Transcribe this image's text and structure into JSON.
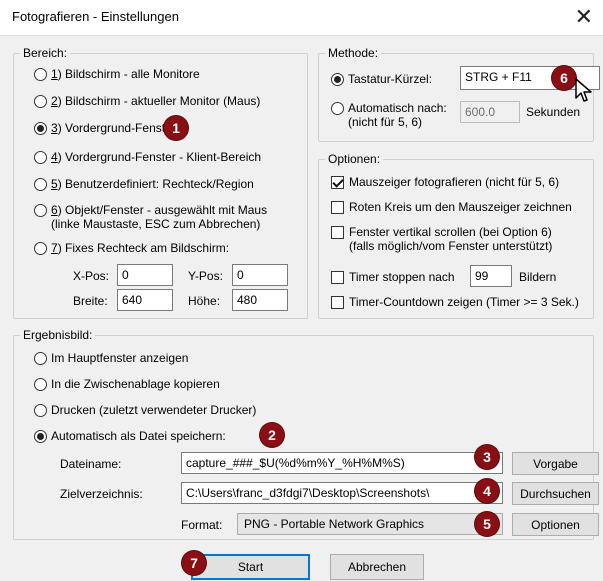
{
  "window": {
    "title": "Fotografieren - Einstellungen",
    "close": "✕"
  },
  "bereich": {
    "legend": "Bereich:",
    "options": [
      {
        "key": "1",
        "label": ") Bildschirm - alle Monitore",
        "selected": false
      },
      {
        "key": "2",
        "label": ") Bildschirm - aktueller Monitor (Maus)",
        "selected": false
      },
      {
        "key": "3",
        "label": ") Vordergrund-Fenster",
        "selected": true
      },
      {
        "key": "4",
        "label": ") Vordergrund-Fenster - Klient-Bereich",
        "selected": false
      },
      {
        "key": "5",
        "label": ") Benutzerdefiniert: Rechteck/Region",
        "selected": false
      },
      {
        "key": "6",
        "label": ") Objekt/Fenster - ausgewählt mit Maus",
        "label2": "(linke Maustaste, ESC zum Abbrechen)",
        "selected": false
      },
      {
        "key": "7",
        "label": ") Fixes Rechteck am Bildschirm:",
        "selected": false
      }
    ],
    "xpos_label": "X-Pos:",
    "xpos": "0",
    "ypos_label": "Y-Pos:",
    "ypos": "0",
    "breite_label": "Breite:",
    "breite": "640",
    "hoehe_label": "Höhe:",
    "hoehe": "480"
  },
  "methode": {
    "legend": "Methode:",
    "tastatur_label": "Tastatur-Kürzel:",
    "tastatur_value": "STRG + F11",
    "auto_label": "Automatisch nach:",
    "auto_label2": "(nicht für 5, 6)",
    "auto_value": "600.0",
    "auto_unit": "Sekunden"
  },
  "optionen": {
    "legend": "Optionen:",
    "mauszeiger": "Mauszeiger fotografieren (nicht für 5, 6)",
    "roter_kreis": "Roten Kreis um den Mauszeiger zeichnen",
    "scrollen": "Fenster vertikal scrollen (bei Option 6)",
    "scrollen2": "(falls möglich/vom Fenster unterstützt)",
    "timer_label": "Timer stoppen nach",
    "timer_value": "99",
    "timer_unit": "Bildern",
    "countdown": "Timer-Countdown zeigen (Timer >= 3 Sek.)"
  },
  "ergebnis": {
    "legend": "Ergebnisbild:",
    "options": [
      {
        "label": "Im Hauptfenster anzeigen",
        "selected": false
      },
      {
        "label": "In die Zwischenablage kopieren",
        "selected": false
      },
      {
        "label": "Drucken (zuletzt verwendeter Drucker)",
        "selected": false
      },
      {
        "label": "Automatisch als Datei speichern:",
        "selected": true
      }
    ],
    "dateiname_label": "Dateiname:",
    "dateiname": "capture_###_$U(%d%m%Y_%H%M%S)",
    "vorgabe": "Vorgabe",
    "ziel_label": "Zielverzeichnis:",
    "ziel": "C:\\Users\\franc_d3fdgi7\\Desktop\\Screenshots\\",
    "durchsuchen": "Durchsuchen",
    "format_label": "Format:",
    "format": "PNG - Portable Network Graphics",
    "optionen_btn": "Optionen"
  },
  "buttons": {
    "start": "Start",
    "abbrechen": "Abbrechen"
  },
  "badges": [
    "1",
    "2",
    "3",
    "4",
    "5",
    "6",
    "7"
  ],
  "colors": {
    "badge": "#8a0f14",
    "accent": "#0078d7"
  }
}
